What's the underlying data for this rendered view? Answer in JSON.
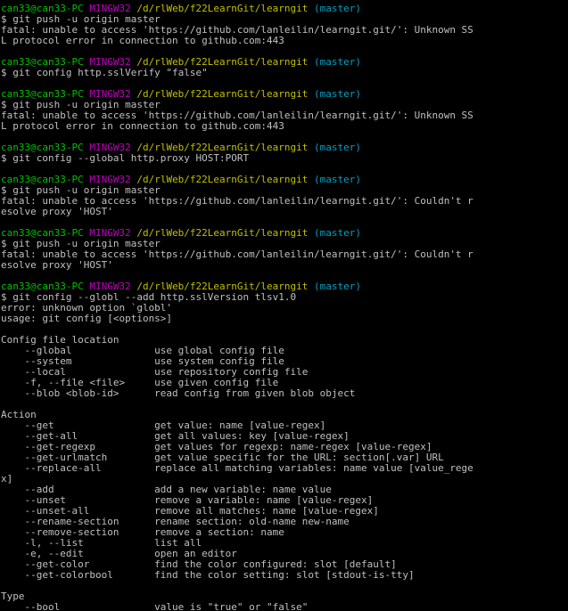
{
  "colors": {
    "background": "#000000",
    "text": "#c0c0c0",
    "prompt_user": "#00c000",
    "prompt_shell": "#c000c0",
    "prompt_path": "#c0c000",
    "prompt_branch": "#00a0c0"
  },
  "prompt": {
    "user_host": "can33@can33-PC",
    "shell": "MINGW32",
    "path": "/d/rlWeb/f22LearnGit/learngit",
    "branch": "(master)"
  },
  "lines": [
    {
      "kind": "prompt"
    },
    {
      "kind": "text",
      "text": "$ git push -u origin master"
    },
    {
      "kind": "text",
      "text": "fatal: unable to access 'https://github.com/lanleilin/learngit.git/': Unknown SS"
    },
    {
      "kind": "text",
      "text": "L protocol error in connection to github.com:443"
    },
    {
      "kind": "text",
      "text": ""
    },
    {
      "kind": "prompt"
    },
    {
      "kind": "text",
      "text": "$ git config http.sslVerify \"false\""
    },
    {
      "kind": "text",
      "text": ""
    },
    {
      "kind": "prompt"
    },
    {
      "kind": "text",
      "text": "$ git push -u origin master"
    },
    {
      "kind": "text",
      "text": "fatal: unable to access 'https://github.com/lanleilin/learngit.git/': Unknown SS"
    },
    {
      "kind": "text",
      "text": "L protocol error in connection to github.com:443"
    },
    {
      "kind": "text",
      "text": ""
    },
    {
      "kind": "prompt"
    },
    {
      "kind": "text",
      "text": "$ git config --global http.proxy HOST:PORT"
    },
    {
      "kind": "text",
      "text": ""
    },
    {
      "kind": "prompt"
    },
    {
      "kind": "text",
      "text": "$ git push -u origin master"
    },
    {
      "kind": "text",
      "text": "fatal: unable to access 'https://github.com/lanleilin/learngit.git/': Couldn't r"
    },
    {
      "kind": "text",
      "text": "esolve proxy 'HOST'"
    },
    {
      "kind": "text",
      "text": ""
    },
    {
      "kind": "prompt"
    },
    {
      "kind": "text",
      "text": "$ git push -u origin master"
    },
    {
      "kind": "text",
      "text": "fatal: unable to access 'https://github.com/lanleilin/learngit.git/': Couldn't r"
    },
    {
      "kind": "text",
      "text": "esolve proxy 'HOST'"
    },
    {
      "kind": "text",
      "text": ""
    },
    {
      "kind": "prompt"
    },
    {
      "kind": "text",
      "text": "$ git config --globl --add http.sslVersion tlsv1.0"
    },
    {
      "kind": "text",
      "text": "error: unknown option `globl'"
    },
    {
      "kind": "text",
      "text": "usage: git config [<options>]"
    },
    {
      "kind": "text",
      "text": ""
    },
    {
      "kind": "text",
      "text": "Config file location"
    },
    {
      "kind": "text",
      "text": "    --global              use global config file"
    },
    {
      "kind": "text",
      "text": "    --system              use system config file"
    },
    {
      "kind": "text",
      "text": "    --local               use repository config file"
    },
    {
      "kind": "text",
      "text": "    -f, --file <file>     use given config file"
    },
    {
      "kind": "text",
      "text": "    --blob <blob-id>      read config from given blob object"
    },
    {
      "kind": "text",
      "text": ""
    },
    {
      "kind": "text",
      "text": "Action"
    },
    {
      "kind": "text",
      "text": "    --get                 get value: name [value-regex]"
    },
    {
      "kind": "text",
      "text": "    --get-all             get all values: key [value-regex]"
    },
    {
      "kind": "text",
      "text": "    --get-regexp          get values for regexp: name-regex [value-regex]"
    },
    {
      "kind": "text",
      "text": "    --get-urlmatch        get value specific for the URL: section[.var] URL"
    },
    {
      "kind": "text",
      "text": "    --replace-all         replace all matching variables: name value [value_rege"
    },
    {
      "kind": "text",
      "text": "x]"
    },
    {
      "kind": "text",
      "text": "    --add                 add a new variable: name value"
    },
    {
      "kind": "text",
      "text": "    --unset               remove a variable: name [value-regex]"
    },
    {
      "kind": "text",
      "text": "    --unset-all           remove all matches: name [value-regex]"
    },
    {
      "kind": "text",
      "text": "    --rename-section      rename section: old-name new-name"
    },
    {
      "kind": "text",
      "text": "    --remove-section      remove a section: name"
    },
    {
      "kind": "text",
      "text": "    -l, --list            list all"
    },
    {
      "kind": "text",
      "text": "    -e, --edit            open an editor"
    },
    {
      "kind": "text",
      "text": "    --get-color           find the color configured: slot [default]"
    },
    {
      "kind": "text",
      "text": "    --get-colorbool       find the color setting: slot [stdout-is-tty]"
    },
    {
      "kind": "text",
      "text": ""
    },
    {
      "kind": "text",
      "text": "Type"
    },
    {
      "kind": "text",
      "text": "    --bool                value is \"true\" or \"false\""
    }
  ]
}
